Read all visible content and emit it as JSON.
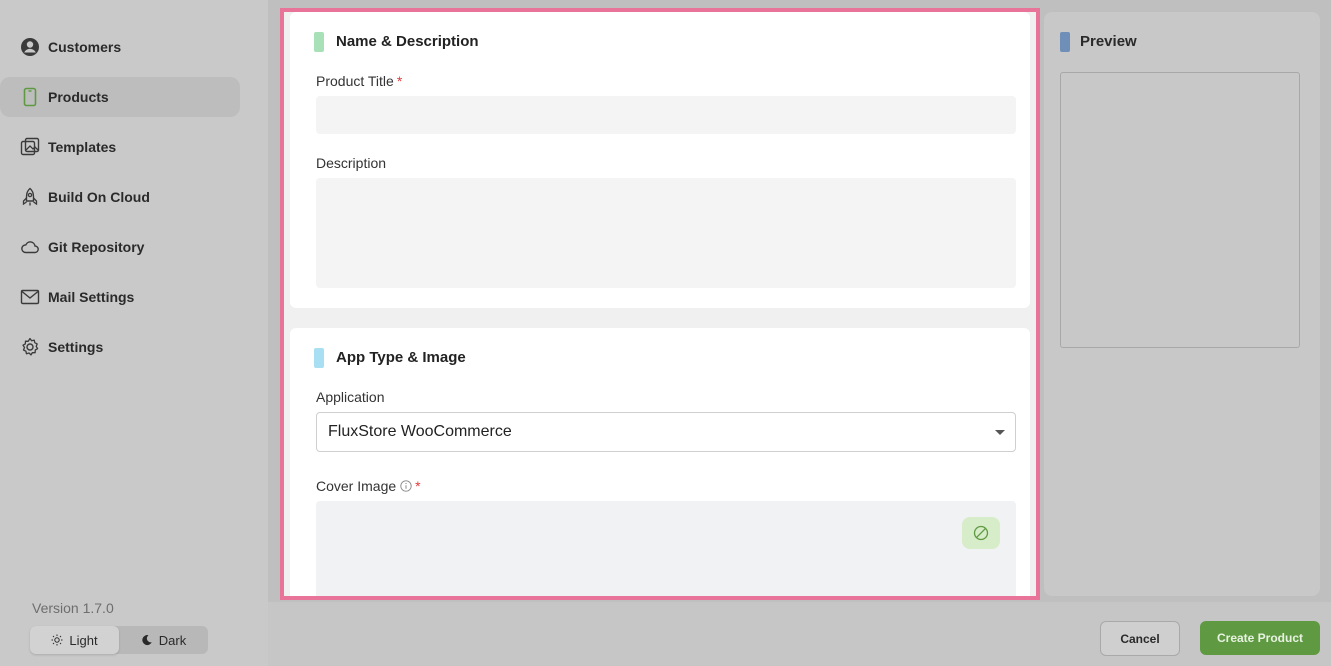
{
  "sidebar": {
    "items": [
      {
        "label": "Customers",
        "icon": "user-circle-icon"
      },
      {
        "label": "Products",
        "icon": "phone-icon",
        "active": true
      },
      {
        "label": "Templates",
        "icon": "images-icon"
      },
      {
        "label": "Build On Cloud",
        "icon": "rocket-icon"
      },
      {
        "label": "Git Repository",
        "icon": "cloud-icon"
      },
      {
        "label": "Mail Settings",
        "icon": "mail-icon"
      },
      {
        "label": "Settings",
        "icon": "gear-icon"
      }
    ],
    "version": "Version 1.7.0",
    "theme": {
      "light_label": "Light",
      "dark_label": "Dark",
      "selected": "Light"
    }
  },
  "form": {
    "name_section": {
      "title": "Name & Description",
      "product_title_label": "Product Title",
      "product_title_value": "",
      "description_label": "Description",
      "description_value": "",
      "required_mark": "*"
    },
    "app_section": {
      "title": "App Type & Image",
      "application_label": "Application",
      "application_value": "FluxStore WooCommerce",
      "cover_image_label": "Cover Image",
      "required_mark": "*"
    }
  },
  "preview": {
    "title": "Preview"
  },
  "footer": {
    "cancel_label": "Cancel",
    "create_label": "Create Product"
  },
  "colors": {
    "highlight_border": "#e8749a",
    "name_section_accent": "#a8e0b8",
    "app_section_accent": "#a9dff3",
    "preview_accent": "#6f8fb8",
    "primary_button": "#5f9a43",
    "required": "#e03b3b"
  }
}
